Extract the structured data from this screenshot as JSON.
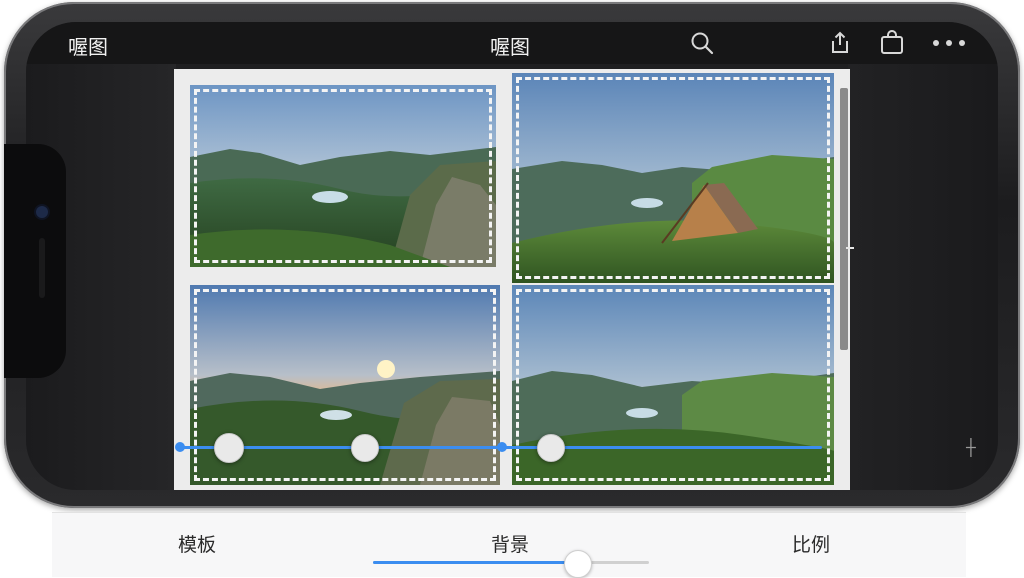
{
  "header": {
    "app_name": "喔图",
    "title": "喔图",
    "icons": [
      "search-icon",
      "share-icon",
      "bag-icon",
      "more-icon"
    ]
  },
  "toolbar": {
    "tabs": [
      {
        "label": "模板"
      },
      {
        "label": "背景"
      },
      {
        "label": "比例"
      }
    ],
    "background_slider_fraction": 0.74
  },
  "colors": {
    "accent": "#3b8df0",
    "toolbar_bg": "#f7f7f8",
    "canvas_bg": "#ececec"
  }
}
